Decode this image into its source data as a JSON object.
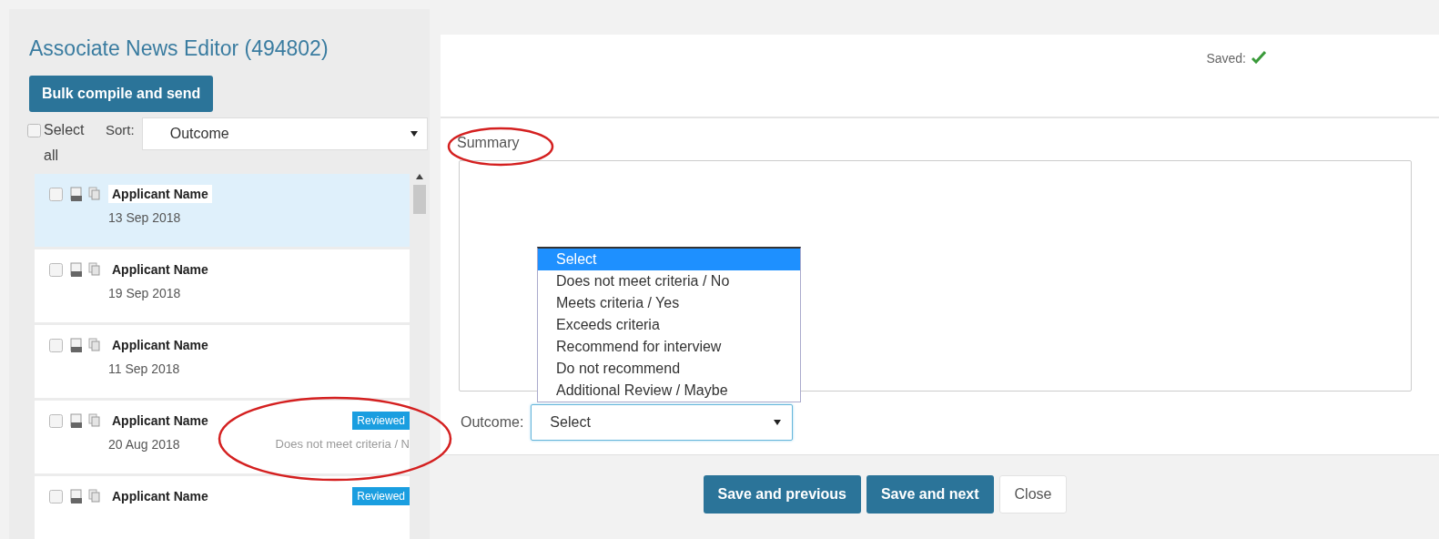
{
  "title": "Associate News Editor (494802)",
  "bulk_button": "Bulk compile and send",
  "select_all": {
    "label": "Select all",
    "checked": false
  },
  "sort": {
    "label": "Sort:",
    "value": "Outcome"
  },
  "applicants": [
    {
      "name": "Applicant Name",
      "date": "13 Sep 2018",
      "selected": true,
      "checked": false
    },
    {
      "name": "Applicant Name",
      "date": "19 Sep 2018",
      "selected": false,
      "checked": false
    },
    {
      "name": "Applicant Name",
      "date": "11 Sep 2018",
      "selected": false,
      "checked": false
    },
    {
      "name": "Applicant Name",
      "date": "20 Aug 2018",
      "selected": false,
      "checked": false,
      "badge": "Reviewed",
      "outcome": "Does not meet criteria / N",
      "circled": true
    },
    {
      "name": "Applicant Name",
      "selected": false,
      "checked": false,
      "badge": "Reviewed"
    }
  ],
  "saved": {
    "label": "Saved:"
  },
  "summary": {
    "label": "Summary",
    "circled": true
  },
  "outcome": {
    "label": "Outcome:",
    "value": "Select",
    "expanded": true,
    "options": [
      {
        "label": "Select",
        "selected": true
      },
      {
        "label": "Does not meet criteria / No",
        "selected": false
      },
      {
        "label": "Meets criteria / Yes",
        "selected": false
      },
      {
        "label": "Exceeds criteria",
        "selected": false
      },
      {
        "label": "Recommend for interview",
        "selected": false
      },
      {
        "label": "Do not recommend",
        "selected": false
      },
      {
        "label": "Additional Review / Maybe",
        "selected": false
      }
    ]
  },
  "buttons": [
    {
      "label": "Save and previous",
      "kind": "primary"
    },
    {
      "label": "Save and next",
      "kind": "primary"
    },
    {
      "label": "Close",
      "kind": "default"
    }
  ]
}
